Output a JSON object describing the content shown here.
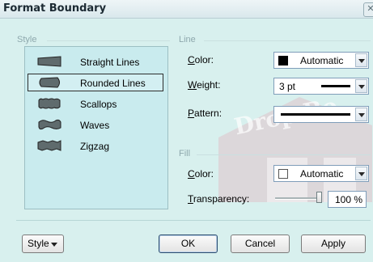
{
  "window": {
    "title": "Format Boundary",
    "close_glyph": "✕"
  },
  "groups": {
    "style": "Style",
    "line": "Line",
    "fill": "Fill"
  },
  "style_list": {
    "items": [
      {
        "label": "Straight Lines",
        "icon": "straight-lines-icon",
        "selected": false
      },
      {
        "label": "Rounded Lines",
        "icon": "rounded-lines-icon",
        "selected": true
      },
      {
        "label": "Scallops",
        "icon": "scallops-icon",
        "selected": false
      },
      {
        "label": "Waves",
        "icon": "waves-icon",
        "selected": false
      },
      {
        "label": "Zigzag",
        "icon": "zigzag-icon",
        "selected": false
      }
    ]
  },
  "line": {
    "color": {
      "label_hotkey": "C",
      "label_rest": "olor:",
      "value": "Automatic",
      "swatch": "#000000"
    },
    "weight": {
      "label_hotkey": "W",
      "label_rest": "eight:",
      "value": "3 pt"
    },
    "pattern": {
      "label_hotkey": "P",
      "label_rest": "attern:"
    }
  },
  "fill": {
    "color": {
      "label_hotkey": "C",
      "label_rest": "olor:",
      "value": "Automatic",
      "swatch": "#ffffff"
    },
    "transparency": {
      "label_hotkey": "T",
      "label_rest": "ransparency:",
      "value": "100 %",
      "level": 1.0
    }
  },
  "buttons": {
    "style": "Style",
    "ok": "OK",
    "cancel": "Cancel",
    "apply": "Apply"
  },
  "watermark": {
    "text": "Drop Bo"
  },
  "colors": {
    "accent": "#2c4c6e",
    "panel": "#d8f0ee",
    "list": "#c9ebee"
  }
}
